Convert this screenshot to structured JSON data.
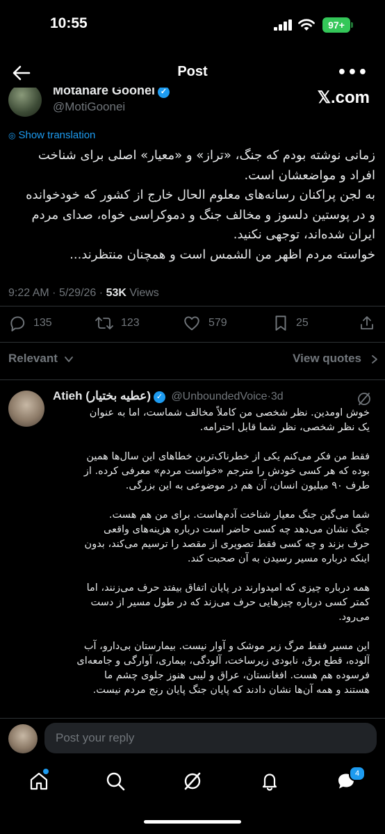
{
  "status_bar": {
    "time": "10:55",
    "battery": "97+"
  },
  "header": {
    "title": "Post"
  },
  "author": {
    "name": "Motahare Goonei",
    "handle": "@MotiGoonei",
    "source_mark": "𝕏.com"
  },
  "translate": {
    "label": "Show translation"
  },
  "tweet": {
    "lines": [
      "زمانی نوشته بودم که جنگ، «تراز» و «معیار» اصلی برای شناخت",
      "افراد و مواضعشان است.",
      "به لجن پراکنان رسانه‌های معلوم الحال خارج از کشور که خودخوانده",
      "و در پوستین دلسوز و مخالف جنگ و دموکراسی خواه، صدای مردم",
      "ایران شده‌اند، توجهی نکنید.",
      "خواسته مردم اظهر من الشمس است و همچنان منتظرند..."
    ],
    "time": "9:22 AM",
    "date": "5/29/26",
    "views_count": "53K",
    "views_label": "Views"
  },
  "actions": {
    "replies": "135",
    "reposts": "123",
    "likes": "579",
    "bookmarks": "25"
  },
  "filters": {
    "sort": "Relevant",
    "view_quotes": "View quotes"
  },
  "reply": {
    "name": "Atieh (عطیه بختیار)",
    "handle": "@UnboundedVoice",
    "age": "3d",
    "paragraphs": [
      [
        "خوش اومدین. نظر شخصی من کاملاً مخالف شماست، اما به عنوان",
        "یک نظر شخصی، نظر شما قابل احترامه."
      ],
      [
        "فقط من فکر می‌کنم یکی از خطرناک‌ترین خطاهای این سال‌ها همین",
        "بوده که هر کسی خودش را مترجم «خواست مردم» معرفی کرده. از",
        "طرف ۹۰ میلیون انسان، آن هم در موضوعی به این بزرگی."
      ],
      [
        "شما می‌گین جنگ معیار شناخت آدم‌هاست. برای من هم هست.",
        "جنگ نشان می‌دهد چه کسی حاضر است درباره هزینه‌های واقعی",
        "حرف بزند و چه کسی فقط تصویری از مقصد را ترسیم می‌کند، بدون",
        "اینکه درباره مسیر رسیدن به آن صحبت کند."
      ],
      [
        "همه درباره چیزی که امیدوارند در پایان اتفاق بیفتد حرف می‌زنند، اما",
        "کمتر کسی درباره چیزهایی حرف می‌زند که در طول مسیر از دست",
        "می‌رود."
      ],
      [
        "این مسیر فقط مرگ زیر موشک و آوار نیست. بیمارستان بی‌دارو، آب",
        "آلوده، قطع برق، نابودی زیرساخت، آلودگی، بیماری، آوارگی و جامعه‌ای",
        "فرسوده هم هست. افغانستان، عراق و لیبی هنوز جلوی چشم ما",
        "هستند و همه آن‌ها نشان دادند که پایان جنگ پایان رنج مردم نیست."
      ]
    ]
  },
  "composer": {
    "placeholder": "Post your reply"
  },
  "tabbar": {
    "messages_badge": "4"
  },
  "colors": {
    "accent": "#1d9bf0",
    "background": "#000000",
    "muted": "#71767b",
    "text": "#e7e9ea",
    "battery": "#34c759"
  }
}
